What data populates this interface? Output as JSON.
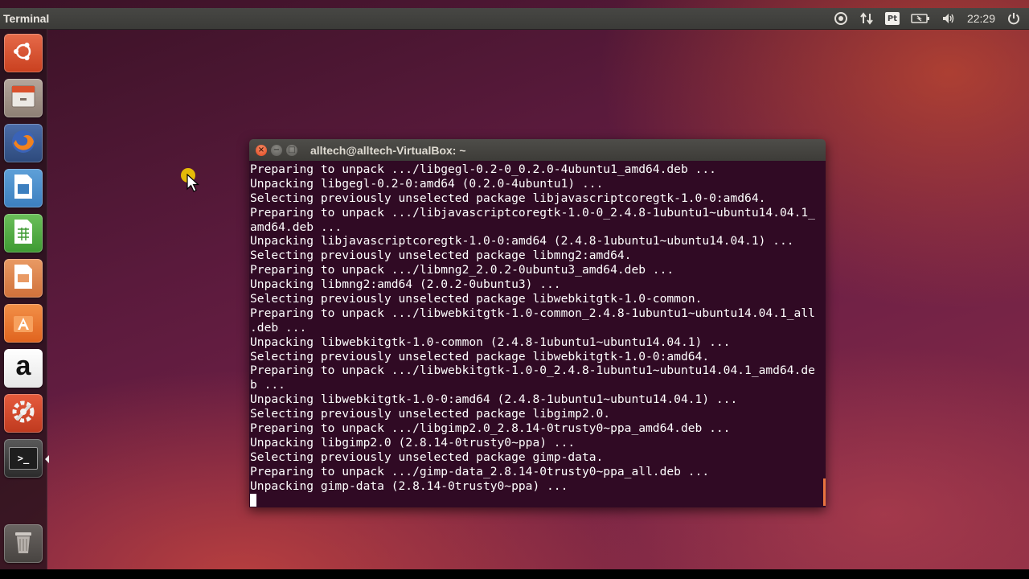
{
  "top_panel": {
    "app_title": "Terminal",
    "indicators": {
      "pt_badge": "Pt",
      "clock": "22:29",
      "settings_icon": "gear-icon",
      "network_icon": "network-updown-icon",
      "battery_icon": "battery-icon",
      "volume_icon": "volume-icon",
      "power_icon": "power-icon"
    }
  },
  "launcher": {
    "items": [
      {
        "name": "ubuntu-dash",
        "icon": "ubuntu-logo-icon"
      },
      {
        "name": "files",
        "icon": "file-cabinet-icon"
      },
      {
        "name": "firefox",
        "icon": "firefox-icon"
      },
      {
        "name": "libreoffice-writer",
        "icon": "writer-document-icon"
      },
      {
        "name": "libreoffice-calc",
        "icon": "calc-spreadsheet-icon"
      },
      {
        "name": "libreoffice-impress",
        "icon": "impress-presentation-icon"
      },
      {
        "name": "ubuntu-software-center",
        "icon": "software-center-icon"
      },
      {
        "name": "amazon",
        "icon": "amazon-icon",
        "glyph": "a"
      },
      {
        "name": "system-settings",
        "icon": "settings-wrench-icon"
      },
      {
        "name": "terminal",
        "icon": "terminal-icon",
        "glyph": ">_",
        "active": true
      },
      {
        "name": "trash",
        "icon": "trash-icon"
      }
    ]
  },
  "terminal": {
    "title": "alltech@alltech-VirtualBox: ~",
    "close_glyph": "×",
    "min_glyph": "−",
    "max_glyph": "□",
    "lines": [
      "Preparing to unpack .../libgegl-0.2-0_0.2.0-4ubuntu1_amd64.deb ...",
      "Unpacking libgegl-0.2-0:amd64 (0.2.0-4ubuntu1) ...",
      "Selecting previously unselected package libjavascriptcoregtk-1.0-0:amd64.",
      "Preparing to unpack .../libjavascriptcoregtk-1.0-0_2.4.8-1ubuntu1~ubuntu14.04.1_",
      "amd64.deb ...",
      "Unpacking libjavascriptcoregtk-1.0-0:amd64 (2.4.8-1ubuntu1~ubuntu14.04.1) ...",
      "Selecting previously unselected package libmng2:amd64.",
      "Preparing to unpack .../libmng2_2.0.2-0ubuntu3_amd64.deb ...",
      "Unpacking libmng2:amd64 (2.0.2-0ubuntu3) ...",
      "Selecting previously unselected package libwebkitgtk-1.0-common.",
      "Preparing to unpack .../libwebkitgtk-1.0-common_2.4.8-1ubuntu1~ubuntu14.04.1_all",
      ".deb ...",
      "Unpacking libwebkitgtk-1.0-common (2.4.8-1ubuntu1~ubuntu14.04.1) ...",
      "Selecting previously unselected package libwebkitgtk-1.0-0:amd64.",
      "Preparing to unpack .../libwebkitgtk-1.0-0_2.4.8-1ubuntu1~ubuntu14.04.1_amd64.de",
      "b ...",
      "Unpacking libwebkitgtk-1.0-0:amd64 (2.4.8-1ubuntu1~ubuntu14.04.1) ...",
      "Selecting previously unselected package libgimp2.0.",
      "Preparing to unpack .../libgimp2.0_2.8.14-0trusty0~ppa_amd64.deb ...",
      "Unpacking libgimp2.0 (2.8.14-0trusty0~ppa) ...",
      "Selecting previously unselected package gimp-data.",
      "Preparing to unpack .../gimp-data_2.8.14-0trusty0~ppa_all.deb ...",
      "Unpacking gimp-data (2.8.14-0trusty0~ppa) ..."
    ]
  },
  "colors": {
    "terminal_bg": "#300a24",
    "terminal_fg": "#ffffff",
    "close_button": "#e0451e",
    "panel_bg": "#3c3b37",
    "scroll_indicator": "#e9743f"
  }
}
